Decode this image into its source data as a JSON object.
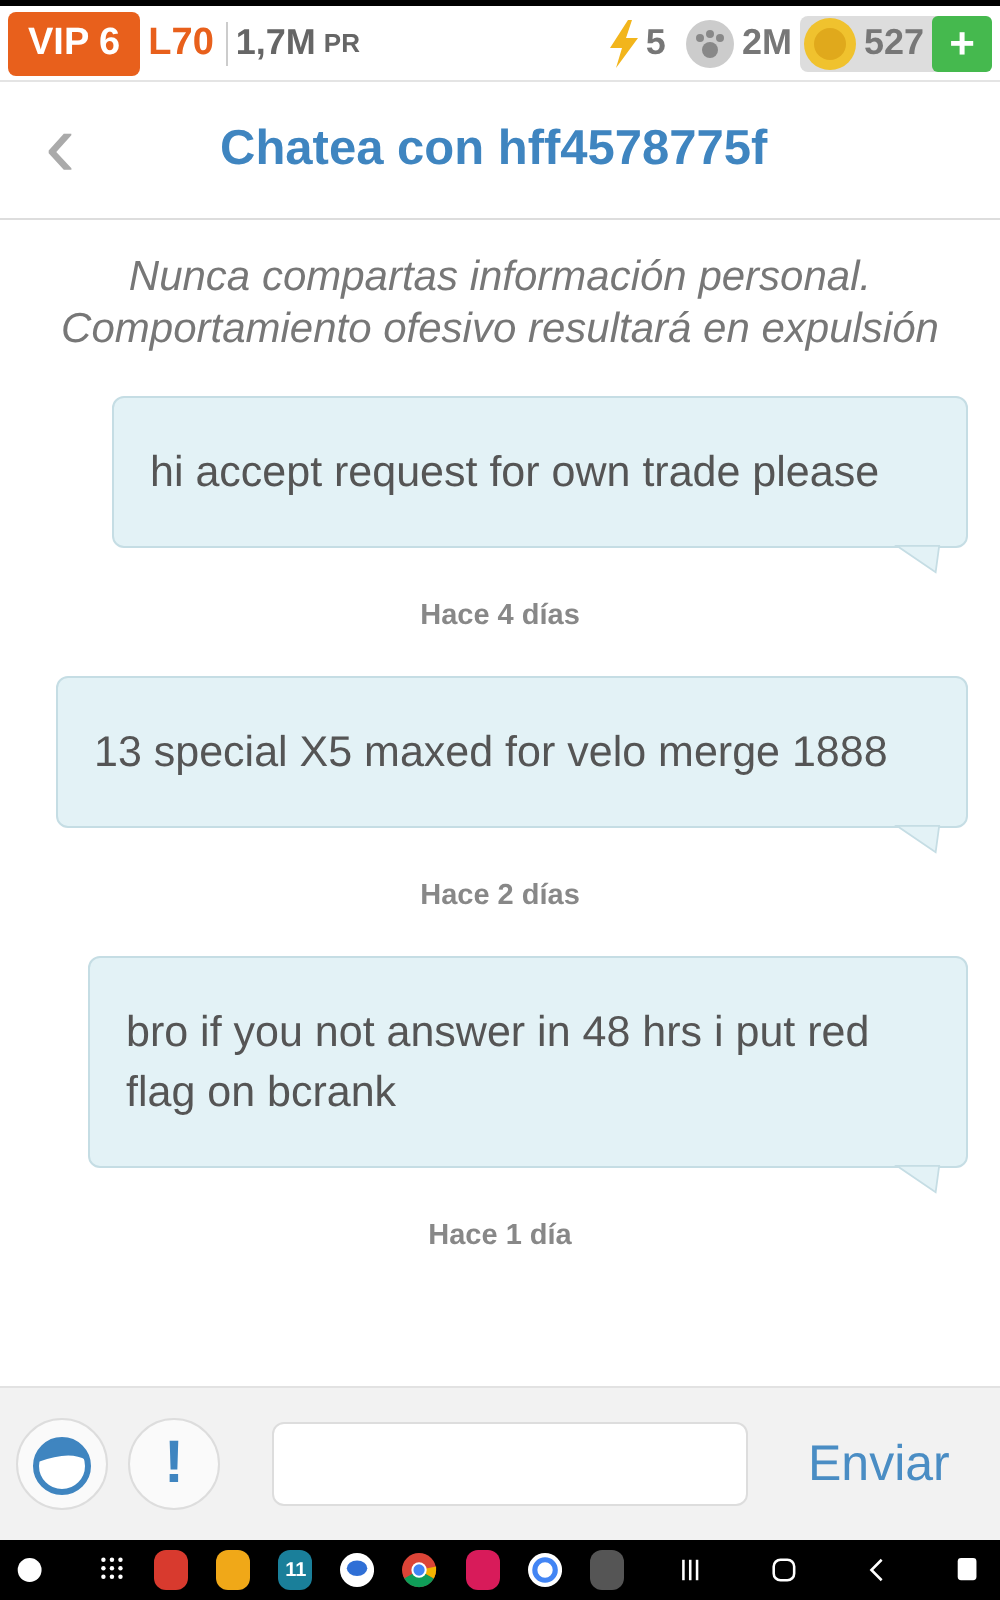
{
  "top_bar": {
    "vip": "VIP 6",
    "level": "L70",
    "power": "1,7M",
    "power_unit": "PR",
    "energy": "5",
    "paws": "2M",
    "coins": "527",
    "add": "+"
  },
  "header": {
    "back": "‹",
    "title": "Chatea con hff4578775f"
  },
  "notice": "Nunca compartas información personal. Comportamiento ofesivo resultará en expulsión",
  "messages": [
    {
      "kind": "message",
      "text": "hi accept request for own trade please"
    },
    {
      "kind": "time",
      "text": "Hace 4 días"
    },
    {
      "kind": "message",
      "text": "13 special X5 maxed for velo merge 1888"
    },
    {
      "kind": "time",
      "text": "Hace 2 días"
    },
    {
      "kind": "message",
      "text": "bro if you not answer in 48 hrs i put red flag on bcrank"
    },
    {
      "kind": "time",
      "text": "Hace 1 día"
    }
  ],
  "composer": {
    "alert": "!",
    "send": "Enviar"
  },
  "taskbar": {
    "calendar_day": "11"
  }
}
